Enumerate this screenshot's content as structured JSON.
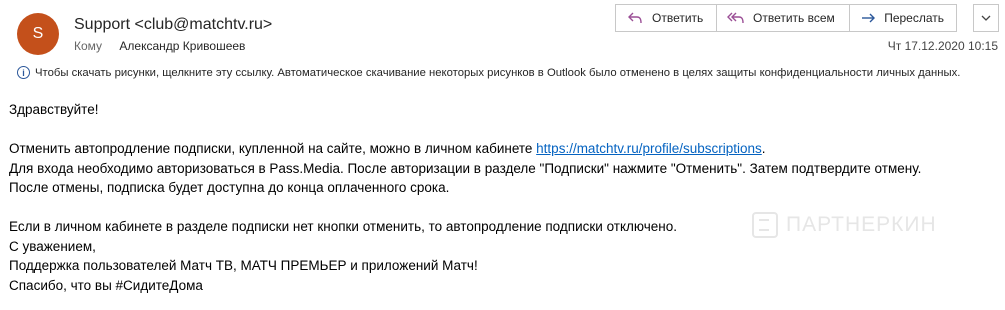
{
  "header": {
    "avatar_initial": "S",
    "avatar_color": "#c4501b",
    "sender": "Support <club@matchtv.ru>",
    "to_label": "Кому",
    "to_name": "Александр Кривошеев",
    "timestamp": "Чт 17.12.2020 10:15"
  },
  "actions": {
    "reply": {
      "label": "Ответить",
      "icon": "reply-icon"
    },
    "reply_all": {
      "label": "Ответить всем",
      "icon": "reply-all-icon"
    },
    "forward": {
      "label": "Переслать",
      "icon": "forward-icon"
    },
    "more": {
      "icon": "more-icon"
    },
    "icon_color": "#9b4f96",
    "forward_icon_color": "#2b579a"
  },
  "infobar": {
    "text": "Чтобы скачать рисунки, щелкните эту ссылку. Автоматическое скачивание некоторых рисунков в Outlook было отменено в целях защиты конфиденциальности личных данных.",
    "icon": "info-icon"
  },
  "message": {
    "greeting": "Здравствуйте!",
    "line1_prefix": "Отменить автопродление подписки, купленной на сайте, можно в личном кабинете ",
    "line1_link": "https://matchtv.ru/profile/subscriptions",
    "line1_suffix": ".",
    "line2": "Для входа необходимо авторизоваться в Pass.Media. После авторизации в разделе \"Подписки\" нажмите \"Отменить\". Затем подтвердите отмену.",
    "line3": "После отмены, подписка будет доступна до конца оплаченного срока.",
    "line4": "Если в личном кабинете в разделе подписки нет кнопки отменить, то автопродление подписки отключено.",
    "line5": "С уважением,",
    "line6": "Поддержка пользователей Матч ТВ, МАТЧ ПРЕМЬЕР и приложений Матч!",
    "line7": "Спасибо, что вы #СидитеДома",
    "link_color": "#0563c1"
  },
  "watermark": {
    "text": "ПАРТНЕРКИН"
  }
}
